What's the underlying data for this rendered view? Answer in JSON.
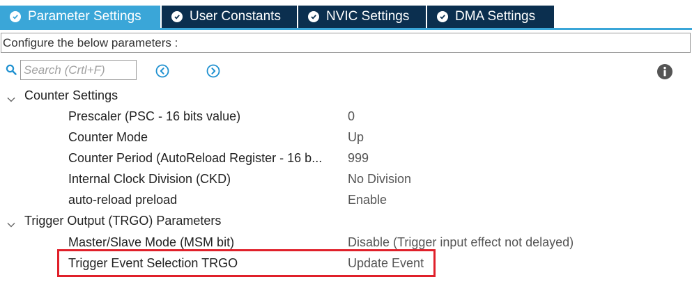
{
  "tabs": [
    {
      "label": "Parameter Settings",
      "active": true
    },
    {
      "label": "User Constants",
      "active": false
    },
    {
      "label": "NVIC Settings",
      "active": false
    },
    {
      "label": "DMA Settings",
      "active": false
    }
  ],
  "configure_text": "Configure the below parameters :",
  "search": {
    "placeholder": "Search (Crtl+F)",
    "value": ""
  },
  "icons": {
    "search": "search-icon",
    "prev": "circle-chevron-left-icon",
    "next": "circle-chevron-right-icon",
    "info": "info-icon",
    "tab_check": "check-circle-icon",
    "group_toggle": "chevron-down-icon"
  },
  "colors": {
    "active_tab": "#3aa6d8",
    "inactive_tab": "#0b2f4f",
    "highlight_border": "#e0202a",
    "nav_icon": "#1e90d0"
  },
  "groups": [
    {
      "label": "Counter Settings",
      "expanded": true,
      "params": [
        {
          "label": "Prescaler (PSC - 16 bits value)",
          "value": "0"
        },
        {
          "label": "Counter Mode",
          "value": "Up"
        },
        {
          "label": "Counter Period (AutoReload Register - 16 b...",
          "value": "999"
        },
        {
          "label": "Internal Clock Division (CKD)",
          "value": "No Division"
        },
        {
          "label": "auto-reload preload",
          "value": "Enable"
        }
      ]
    },
    {
      "label": "Trigger Output (TRGO) Parameters",
      "expanded": true,
      "params": [
        {
          "label": "Master/Slave Mode (MSM bit)",
          "value": "Disable (Trigger input effect not delayed)"
        },
        {
          "label": "Trigger Event Selection TRGO",
          "value": "Update Event"
        }
      ]
    }
  ]
}
